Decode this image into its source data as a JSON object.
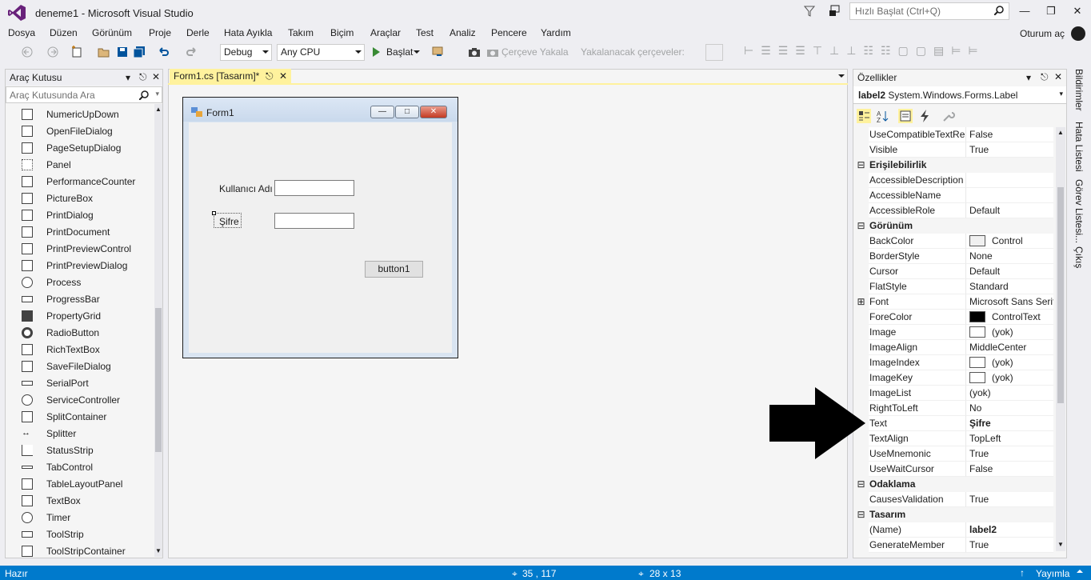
{
  "window": {
    "title": "deneme1 - Microsoft Visual Studio",
    "quick_launch_placeholder": "Hızlı Başlat (Ctrl+Q)"
  },
  "menu": [
    "Dosya",
    "Düzen",
    "Görünüm",
    "Proje",
    "Derle",
    "Hata Ayıkla",
    "Takım",
    "Biçim",
    "Araçlar",
    "Test",
    "Analiz",
    "Pencere",
    "Yardım"
  ],
  "signin": "Oturum aç",
  "toolbar": {
    "config": "Debug",
    "platform": "Any CPU",
    "start": "Başlat",
    "capture": "Çerçeve Yakala",
    "frames_label": "Yakalanacak çerçeveler:"
  },
  "toolbox": {
    "title": "Araç Kutusu",
    "search_placeholder": "Araç Kutusunda Ara",
    "items": [
      "NumericUpDown",
      "OpenFileDialog",
      "PageSetupDialog",
      "Panel",
      "PerformanceCounter",
      "PictureBox",
      "PrintDialog",
      "PrintDocument",
      "PrintPreviewControl",
      "PrintPreviewDialog",
      "Process",
      "ProgressBar",
      "PropertyGrid",
      "RadioButton",
      "RichTextBox",
      "SaveFileDialog",
      "SerialPort",
      "ServiceController",
      "SplitContainer",
      "Splitter",
      "StatusStrip",
      "TabControl",
      "TableLayoutPanel",
      "TextBox",
      "Timer",
      "ToolStrip",
      "ToolStripContainer"
    ]
  },
  "doc_tab": "Form1.cs [Tasarım]*",
  "form": {
    "title": "Form1",
    "label_user": "Kullanıcı Adı",
    "label_pass": "Şifre",
    "button": "button1"
  },
  "properties": {
    "title": "Özellikler",
    "selector_name": "label2",
    "selector_type": "System.Windows.Forms.Label",
    "rows": [
      {
        "n": "UseCompatibleTextRer",
        "v": "False"
      },
      {
        "n": "Visible",
        "v": "True"
      },
      {
        "cat": "Erişilebilirlik"
      },
      {
        "n": "AccessibleDescription",
        "v": ""
      },
      {
        "n": "AccessibleName",
        "v": ""
      },
      {
        "n": "AccessibleRole",
        "v": "Default"
      },
      {
        "cat": "Görünüm"
      },
      {
        "n": "BackColor",
        "v": "Control",
        "sw": "#f0f0f0"
      },
      {
        "n": "BorderStyle",
        "v": "None"
      },
      {
        "n": "Cursor",
        "v": "Default"
      },
      {
        "n": "FlatStyle",
        "v": "Standard"
      },
      {
        "n": "Font",
        "v": "Microsoft Sans Serif,",
        "exp": true
      },
      {
        "n": "ForeColor",
        "v": "ControlText",
        "sw": "#000000"
      },
      {
        "n": "Image",
        "v": "(yok)",
        "sw": "#ffffff"
      },
      {
        "n": "ImageAlign",
        "v": "MiddleCenter"
      },
      {
        "n": "ImageIndex",
        "v": "(yok)",
        "sw": "#ffffff"
      },
      {
        "n": "ImageKey",
        "v": "(yok)",
        "sw": "#ffffff"
      },
      {
        "n": "ImageList",
        "v": "(yok)"
      },
      {
        "n": "RightToLeft",
        "v": "No"
      },
      {
        "n": "Text",
        "v": "Şifre",
        "bold": true
      },
      {
        "n": "TextAlign",
        "v": "TopLeft"
      },
      {
        "n": "UseMnemonic",
        "v": "True"
      },
      {
        "n": "UseWaitCursor",
        "v": "False"
      },
      {
        "cat": "Odaklama"
      },
      {
        "n": "CausesValidation",
        "v": "True"
      },
      {
        "cat": "Tasarım"
      },
      {
        "n": "(Name)",
        "v": "label2",
        "bold": true
      },
      {
        "n": "GenerateMember",
        "v": "True"
      }
    ]
  },
  "side_tabs": [
    "Bildirimler",
    "Hata Listesi",
    "Görev Listesi...",
    "Çıkış"
  ],
  "status": {
    "ready": "Hazır",
    "pos": "35 , 117",
    "size": "28 x 13",
    "publish": "Yayımla"
  },
  "colors": {
    "accent": "#007acc",
    "tab_active": "#fff29d",
    "vs_purple": "#68217a"
  }
}
